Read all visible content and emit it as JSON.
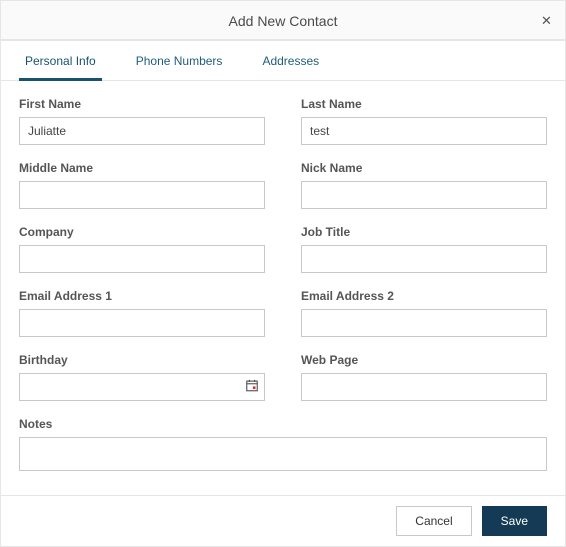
{
  "dialog": {
    "title": "Add New Contact"
  },
  "tabs": {
    "personal": "Personal Info",
    "phone": "Phone Numbers",
    "addresses": "Addresses"
  },
  "labels": {
    "first_name": "First Name",
    "last_name": "Last Name",
    "middle_name": "Middle Name",
    "nick_name": "Nick Name",
    "company": "Company",
    "job_title": "Job Title",
    "email1": "Email Address 1",
    "email2": "Email Address 2",
    "birthday": "Birthday",
    "web_page": "Web Page",
    "notes": "Notes"
  },
  "values": {
    "first_name": "Juliatte",
    "last_name": "test",
    "middle_name": "",
    "nick_name": "",
    "company": "",
    "job_title": "",
    "email1": "",
    "email2": "",
    "birthday": "",
    "web_page": "",
    "notes": ""
  },
  "footer": {
    "cancel": "Cancel",
    "save": "Save"
  }
}
